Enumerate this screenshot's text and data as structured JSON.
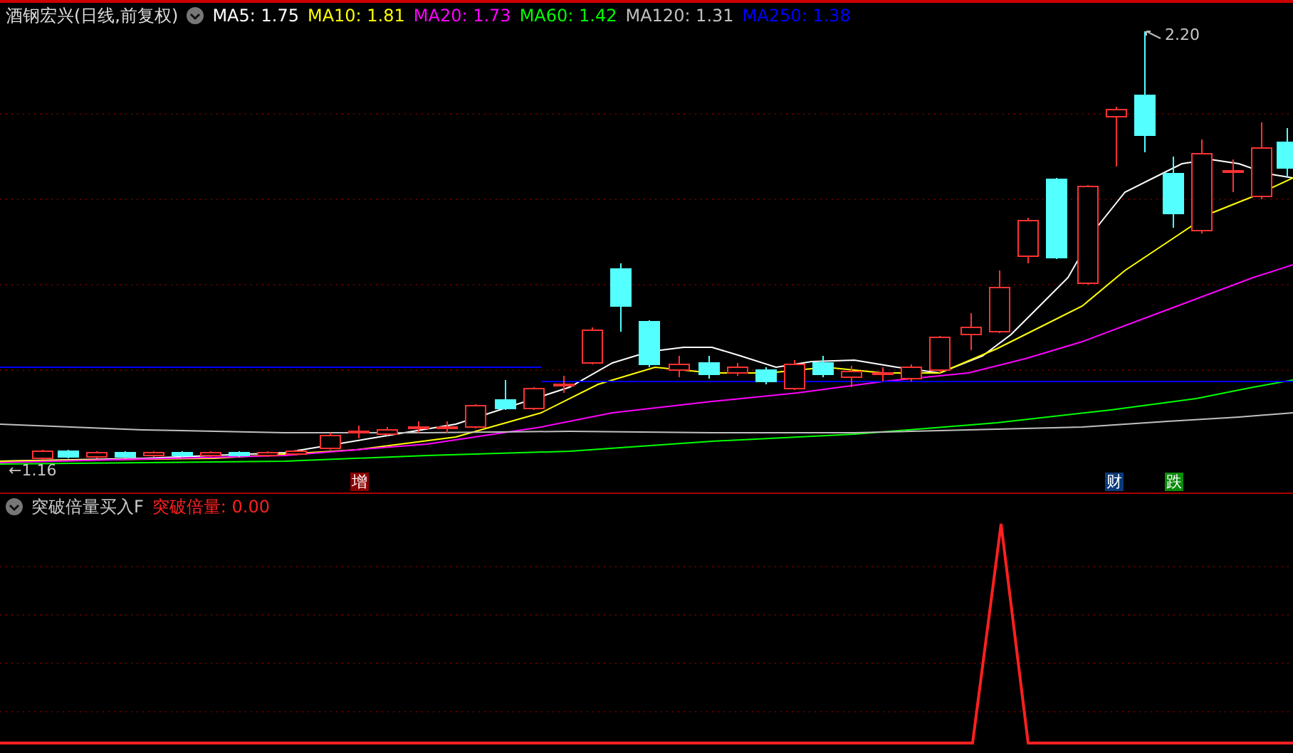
{
  "header": {
    "stock_name": "酒钢宏兴(日线,前复权)",
    "indicators": [
      {
        "label": "MA5: 1.75",
        "color": "#ffffff"
      },
      {
        "label": "MA10: 1.81",
        "color": "#ffff00"
      },
      {
        "label": "MA20: 1.73",
        "color": "#ff00ff"
      },
      {
        "label": "MA60: 1.42",
        "color": "#00ff00"
      },
      {
        "label": "MA120: 1.31",
        "color": "#c0c0c0"
      },
      {
        "label": "MA250: 1.38",
        "color": "#0000ff"
      }
    ]
  },
  "main_chart": {
    "high_marker": "2.20",
    "low_marker": "←1.16",
    "events": [
      {
        "label": "增",
        "color": "#8b0000"
      },
      {
        "label": "财",
        "color": "#0a3a7a"
      },
      {
        "label": "跌",
        "color": "#0a8a0a"
      }
    ]
  },
  "indicator_panel": {
    "name": "突破倍量买入F",
    "value": "突破倍量: 0.00"
  }
}
